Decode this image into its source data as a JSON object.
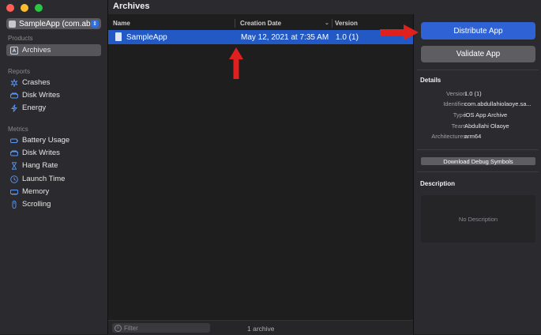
{
  "sidebar": {
    "app_selector": "SampleApp (com.ab...",
    "sections": {
      "products": "Products",
      "reports": "Reports",
      "metrics": "Metrics"
    },
    "products_items": [
      {
        "label": "Archives",
        "icon": "archive-icon",
        "selected": true
      }
    ],
    "reports_items": [
      {
        "label": "Crashes",
        "icon": "crash-icon"
      },
      {
        "label": "Disk Writes",
        "icon": "disk-icon"
      },
      {
        "label": "Energy",
        "icon": "energy-icon"
      }
    ],
    "metrics_items": [
      {
        "label": "Battery Usage",
        "icon": "battery-icon"
      },
      {
        "label": "Disk Writes",
        "icon": "disk-icon"
      },
      {
        "label": "Hang Rate",
        "icon": "hourglass-icon"
      },
      {
        "label": "Launch Time",
        "icon": "clock-icon"
      },
      {
        "label": "Memory",
        "icon": "memory-icon"
      },
      {
        "label": "Scrolling",
        "icon": "scroll-icon"
      }
    ]
  },
  "window": {
    "title": "Archives"
  },
  "table": {
    "columns": [
      "Name",
      "Creation Date",
      "Version"
    ],
    "rows": [
      {
        "name": "SampleApp",
        "date": "May 12, 2021 at 7:35 AM",
        "version": "1.0 (1)",
        "selected": true
      }
    ]
  },
  "footer": {
    "filter_placeholder": "Filter",
    "count": "1 archive"
  },
  "inspector": {
    "distribute_button": "Distribute App",
    "validate_button": "Validate App",
    "details_heading": "Details",
    "details": [
      {
        "label": "Version",
        "value": "1.0 (1)"
      },
      {
        "label": "Identifier",
        "value": "com.abdullahiolaoye.sa..."
      },
      {
        "label": "Type",
        "value": "iOS App Archive"
      },
      {
        "label": "Team",
        "value": "Abdullahi Olaoye"
      },
      {
        "label": "Architectures",
        "value": "arm64"
      }
    ],
    "debug_symbols_button": "Download Debug Symbols",
    "description_heading": "Description",
    "description_placeholder": "No Description"
  },
  "colors": {
    "accent": "#2f63d5",
    "selection": "#2359c4",
    "annotation_arrow": "#e0201e",
    "close": "#ff5f57",
    "minimize": "#febc2e",
    "zoom": "#28c840"
  }
}
